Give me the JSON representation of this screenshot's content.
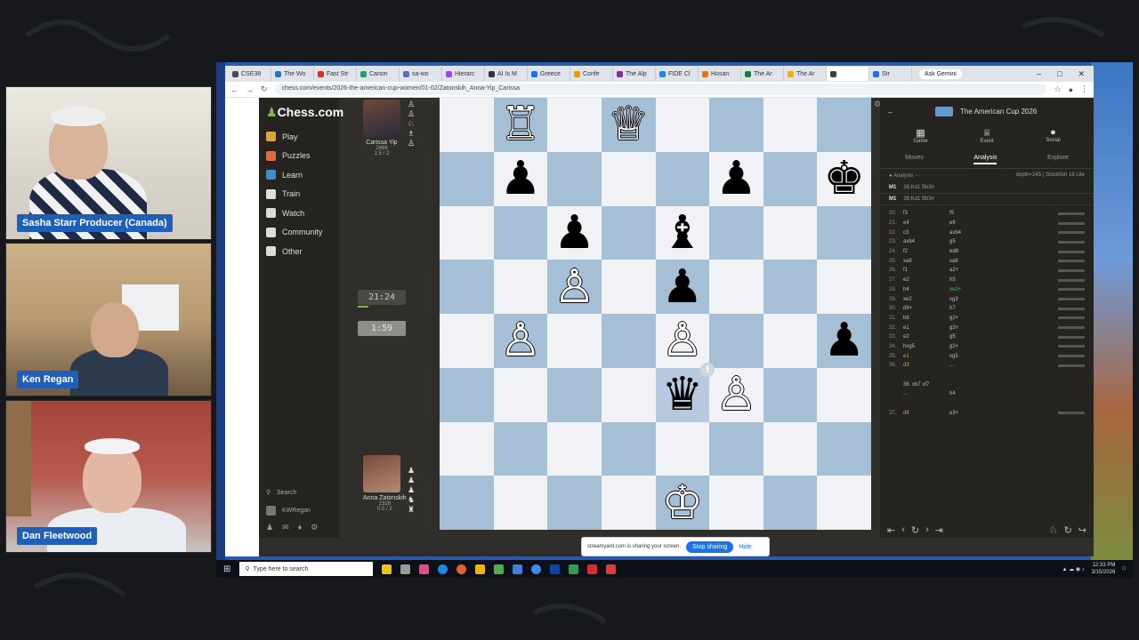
{
  "participants": [
    {
      "name": "Sasha Starr Producer (Canada)"
    },
    {
      "name": "Ken Regan"
    },
    {
      "name": "Dan Fleetwood"
    }
  ],
  "browser": {
    "tabs": [
      "CSE38",
      "The Wo",
      "Fast Str",
      "Canon",
      "sa-wo",
      "Hierarc",
      "AI Is M",
      "Greece",
      "Confe",
      "The Alp",
      "FIDE Cl",
      "Hosan",
      "The Ar",
      "The Ar",
      "",
      "Str"
    ],
    "gemini_label": "Ask Gemini",
    "url": "chess.com/events/2026-the-american-cup-women/01-02/Zatonskih_Anna-Yip_Carissa"
  },
  "chesscom": {
    "logo": "Chess.com",
    "nav": [
      {
        "label": "Play",
        "icon": "play-icon",
        "color": "#e0a43b"
      },
      {
        "label": "Puzzles",
        "icon": "puzzle-icon",
        "color": "#e26b3d"
      },
      {
        "label": "Learn",
        "icon": "learn-icon",
        "color": "#3a8fd6"
      },
      {
        "label": "Train",
        "icon": "train-icon",
        "color": "#dddddd"
      },
      {
        "label": "Watch",
        "icon": "watch-icon",
        "color": "#dddddd"
      },
      {
        "label": "Community",
        "icon": "community-icon",
        "color": "#dddddd"
      },
      {
        "label": "Other",
        "icon": "more-icon",
        "color": "#dddddd"
      }
    ],
    "search_label": "Search",
    "user_label": "KWRegan"
  },
  "players": {
    "top": {
      "name": "Carissa Yip",
      "rating": "2466",
      "score": "1.5 / 2"
    },
    "bottom": {
      "name": "Anna Zatonskih",
      "rating": "2328",
      "score": "0.5 / 2"
    }
  },
  "clocks": {
    "top": "21:24",
    "bottom": "1:59"
  },
  "board": {
    "light_color": "#f0f2f5",
    "dark_color": "#a5bfd6",
    "rows": [
      [
        "",
        "wR",
        "",
        "wQ",
        "",
        "",
        "",
        ""
      ],
      [
        "",
        "bP",
        "",
        "",
        "",
        "bP",
        "",
        "bK"
      ],
      [
        "",
        "",
        "bP",
        "",
        "bB",
        "",
        "",
        ""
      ],
      [
        "",
        "",
        "wP",
        "",
        "bP",
        "",
        "",
        ""
      ],
      [
        "",
        "wP",
        "",
        "",
        "wP",
        "",
        "",
        "bP"
      ],
      [
        "",
        "",
        "",
        "",
        "bQ",
        "wP",
        "",
        ""
      ],
      [
        "",
        "",
        "",
        "",
        "",
        "",
        "",
        ""
      ],
      [
        "",
        "",
        "",
        "",
        "wK",
        "",
        "",
        ""
      ]
    ],
    "badge_square": "e3",
    "badge_symbol": "!"
  },
  "screen_share": {
    "message": "streamyard.com is sharing your screen.",
    "stop_label": "Stop sharing",
    "hide_label": "Hide"
  },
  "analysis": {
    "event_title": "The American Cup 2026",
    "icons": [
      {
        "label": "Game",
        "icon": "game-icon"
      },
      {
        "label": "Event",
        "icon": "trophy-icon"
      },
      {
        "label": "Social",
        "icon": "chat-icon"
      }
    ],
    "tabs": [
      "Moves",
      "Analysis",
      "Explore"
    ],
    "active_tab": "Analysis",
    "engine_label": "Analysis",
    "engine_info": "depth=245 | Stockfish 18 Lite",
    "lines": [
      {
        "tag": "M1",
        "text": "38.Kd1 Bb3#"
      },
      {
        "tag": "M1",
        "text": "38.Kd1 Bb3#"
      }
    ],
    "moves": [
      {
        "n": "20.",
        "w": "f3",
        "b": "f5"
      },
      {
        "n": "21.",
        "w": "e4",
        "b": "e6"
      },
      {
        "n": "22.",
        "w": "c3",
        "b": "axb4"
      },
      {
        "n": "23.",
        "w": "axb4",
        "b": "g5"
      },
      {
        "n": "24.",
        "w": "f2",
        "b": "ed8"
      },
      {
        "n": "25.",
        "w": "xa8",
        "b": "xa8"
      },
      {
        "n": "26.",
        "w": "f1",
        "b": "a2+"
      },
      {
        "n": "27.",
        "w": "e2",
        "b": "h5"
      },
      {
        "n": "28.",
        "w": "h4",
        "b": "xe2+"
      },
      {
        "n": "29.",
        "w": "xe2",
        "b": "xg3"
      },
      {
        "n": "30.",
        "w": "d8+",
        "b": "h7"
      },
      {
        "n": "31.",
        "w": "b8",
        "b": "g2+"
      },
      {
        "n": "32.",
        "w": "e1",
        "b": "g3+"
      },
      {
        "n": "33.",
        "w": "e2",
        "b": "g5"
      },
      {
        "n": "34.",
        "w": "hxg5",
        "b": "g2+"
      },
      {
        "n": "35.",
        "w": "e1",
        "b": "xg5"
      },
      {
        "n": "36.",
        "w": "d3",
        "b": "..."
      },
      {
        "n": "",
        "w": "",
        "b": ""
      },
      {
        "n": "",
        "w": "36. xb7 xf7",
        "b": ""
      },
      {
        "n": "",
        "w": "...",
        "b": "h4"
      },
      {
        "n": "",
        "w": "",
        "b": ""
      },
      {
        "n": "37.",
        "w": "d8",
        "b": "e3+"
      }
    ]
  },
  "taskbar": {
    "search_placeholder": "Type here to search",
    "time": "12:33 PM",
    "date": "3/15/2026"
  }
}
